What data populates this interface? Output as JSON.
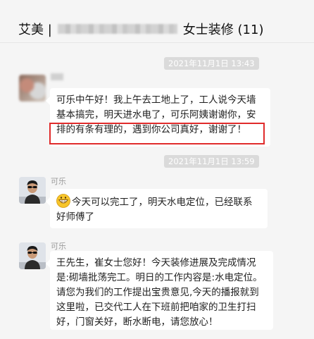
{
  "header": {
    "title_prefix": "艾美 |",
    "title_suffix": "女士装修 (11)"
  },
  "messages": [
    {
      "timestamp": "2021年11月1日 13:43",
      "sender": "",
      "lines": [
        "可乐中午好！我上午去工地上了，工人说今天墙",
        "基本搞完，明天进水电了，可乐阿姨谢谢你，安",
        "排的有条有理的，遇到你公司真好，谢谢了！"
      ]
    },
    {
      "timestamp": "2021年11月1日 13:59",
      "sender": "可乐",
      "lines": [
        "今天可以完工了，明天水电定位，已经联系",
        "好师傅了"
      ],
      "emoji": "grinning-face-emoji"
    },
    {
      "sender": "可乐",
      "lines": [
        "王先生，崔女士您好！今天装修进展及完成情况",
        "是:砌墙批荡完工。明日的工作内容是:水电定位。",
        "请您为我们的工作提出宝贵意见,今天的播报就到",
        "这里啦，已交代工人在下班前把咱家的卫生打扫",
        "好，门窗关好，断水断电，请您放心！"
      ]
    }
  ],
  "colors": {
    "background": "#f5f5f5",
    "bubble": "#ffffff",
    "highlight": "#e02b2b",
    "timestamp_chip": "#dadada"
  }
}
